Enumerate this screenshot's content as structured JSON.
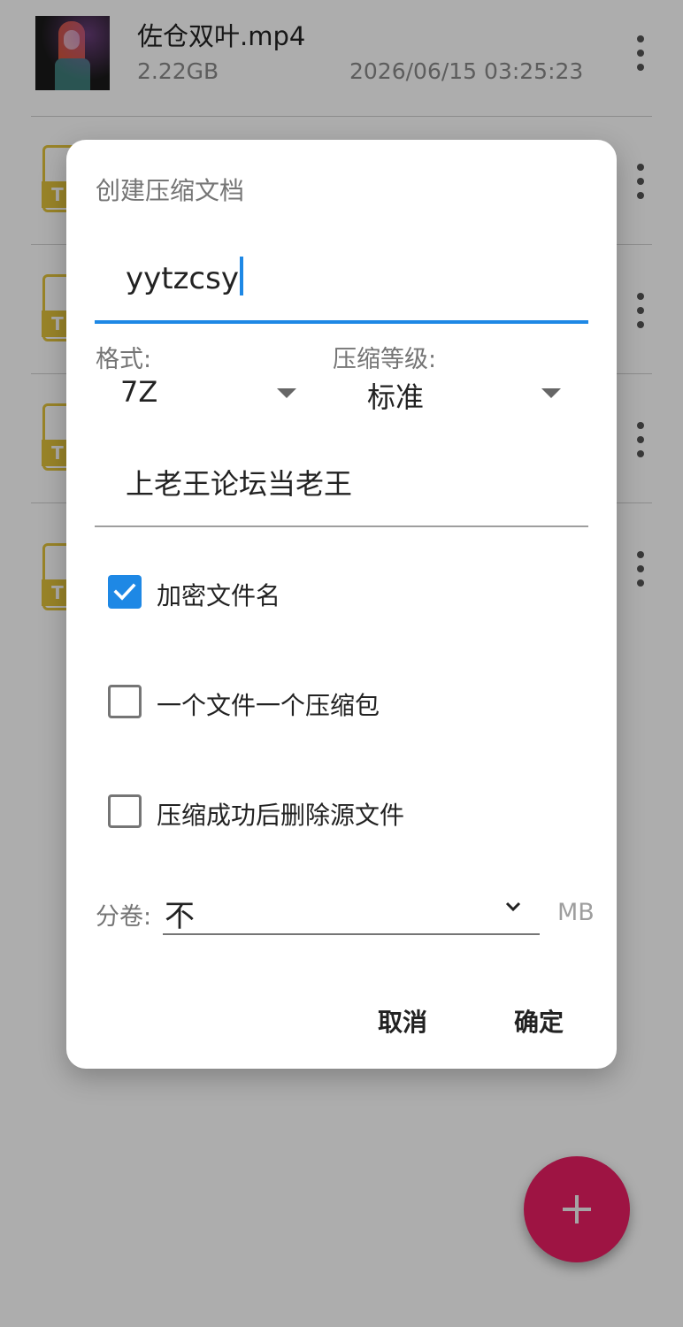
{
  "file_list": {
    "items": [
      {
        "name": "佐仓双叶.mp4",
        "size": "2.22GB",
        "date": "2026/06/15 03:25:23",
        "icon": "video-thumbnail"
      },
      {
        "icon": "text-file-icon",
        "tag": "T"
      },
      {
        "icon": "text-file-icon",
        "tag": "T"
      },
      {
        "icon": "text-file-icon",
        "tag": "T"
      },
      {
        "icon": "text-file-icon",
        "tag": "T"
      }
    ],
    "more_icon": "more-vertical-icon"
  },
  "fab": {
    "icon": "plus-icon",
    "color": "#e91e63"
  },
  "dialog": {
    "title": "创建压缩文档",
    "archive_name": "yytzcsy",
    "format_label": "格式:",
    "format_value": "7Z",
    "level_label": "压缩等级:",
    "level_value": "标准",
    "password_value": "上老王论坛当老王",
    "options": [
      {
        "label": "加密文件名",
        "checked": true
      },
      {
        "label": "一个文件一个压缩包",
        "checked": false
      },
      {
        "label": "压缩成功后删除源文件",
        "checked": false
      }
    ],
    "split_label": "分卷:",
    "split_value": "不",
    "split_unit": "MB",
    "cancel_label": "取消",
    "ok_label": "确定"
  },
  "colors": {
    "accent": "#1e88e5",
    "fab": "#e91e63",
    "file_icon": "#e2c33b"
  }
}
